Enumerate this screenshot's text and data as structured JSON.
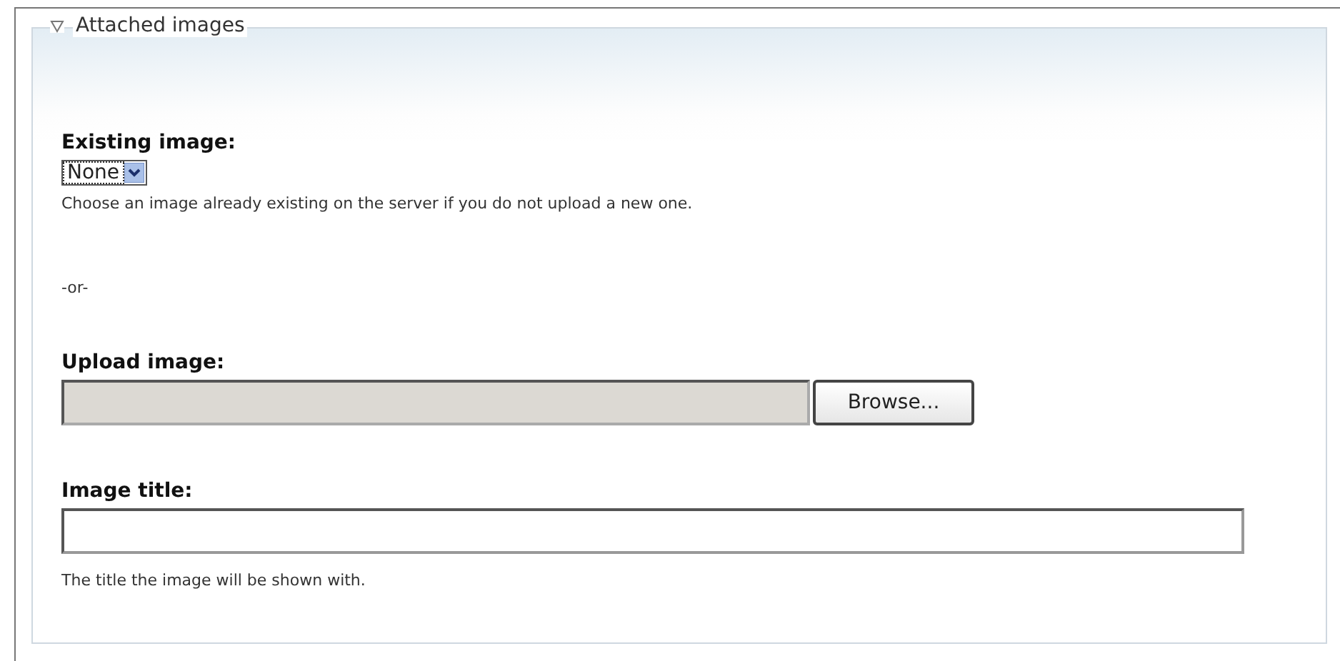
{
  "fieldset": {
    "legend": "Attached images",
    "expanded": true
  },
  "existing": {
    "label": "Existing image:",
    "value": "None",
    "description": "Choose an image already existing on the server if you do not upload a new one."
  },
  "separator": "-or-",
  "upload": {
    "label": "Upload image:",
    "button": "Browse..."
  },
  "title": {
    "label": "Image title:",
    "description": "The title the image will be shown with."
  }
}
